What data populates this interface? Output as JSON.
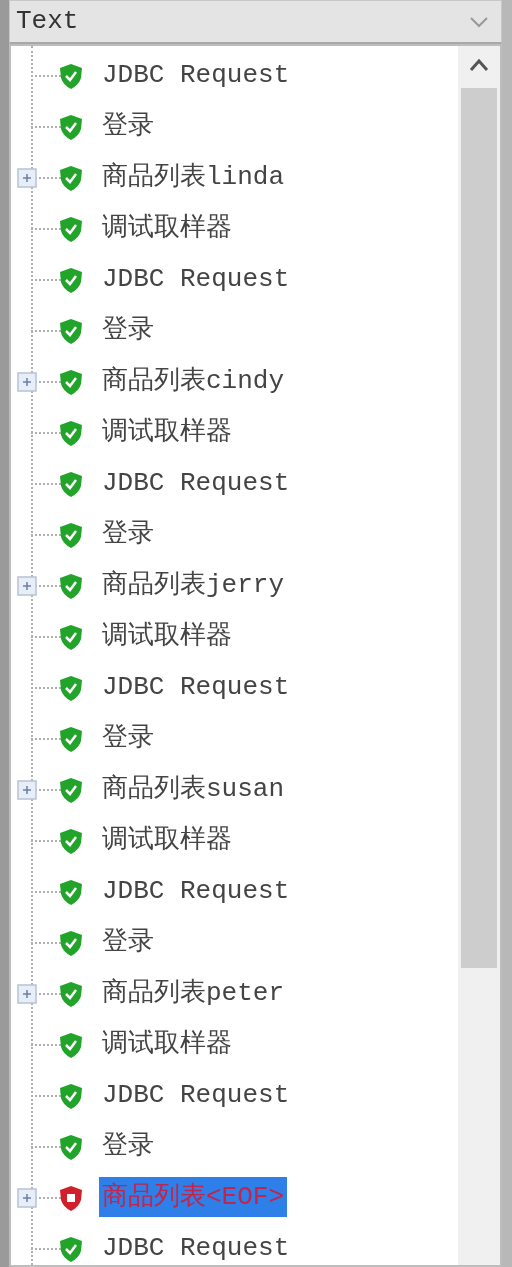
{
  "view_selector": {
    "value": "Text"
  },
  "tree": [
    {
      "label": "JDBC Request",
      "expandable": false,
      "passed": true,
      "selected": false
    },
    {
      "label": "登录",
      "expandable": false,
      "passed": true,
      "selected": false
    },
    {
      "label": "商品列表linda",
      "expandable": true,
      "passed": true,
      "selected": false
    },
    {
      "label": "调试取样器",
      "expandable": false,
      "passed": true,
      "selected": false
    },
    {
      "label": "JDBC Request",
      "expandable": false,
      "passed": true,
      "selected": false
    },
    {
      "label": "登录",
      "expandable": false,
      "passed": true,
      "selected": false
    },
    {
      "label": "商品列表cindy",
      "expandable": true,
      "passed": true,
      "selected": false
    },
    {
      "label": "调试取样器",
      "expandable": false,
      "passed": true,
      "selected": false
    },
    {
      "label": "JDBC Request",
      "expandable": false,
      "passed": true,
      "selected": false
    },
    {
      "label": "登录",
      "expandable": false,
      "passed": true,
      "selected": false
    },
    {
      "label": "商品列表jerry",
      "expandable": true,
      "passed": true,
      "selected": false
    },
    {
      "label": "调试取样器",
      "expandable": false,
      "passed": true,
      "selected": false
    },
    {
      "label": "JDBC Request",
      "expandable": false,
      "passed": true,
      "selected": false
    },
    {
      "label": "登录",
      "expandable": false,
      "passed": true,
      "selected": false
    },
    {
      "label": "商品列表susan",
      "expandable": true,
      "passed": true,
      "selected": false
    },
    {
      "label": "调试取样器",
      "expandable": false,
      "passed": true,
      "selected": false
    },
    {
      "label": "JDBC Request",
      "expandable": false,
      "passed": true,
      "selected": false
    },
    {
      "label": "登录",
      "expandable": false,
      "passed": true,
      "selected": false
    },
    {
      "label": "商品列表peter",
      "expandable": true,
      "passed": true,
      "selected": false
    },
    {
      "label": "调试取样器",
      "expandable": false,
      "passed": true,
      "selected": false
    },
    {
      "label": "JDBC Request",
      "expandable": false,
      "passed": true,
      "selected": false
    },
    {
      "label": "登录",
      "expandable": false,
      "passed": true,
      "selected": false
    },
    {
      "label": "商品列表<EOF>",
      "expandable": true,
      "passed": false,
      "selected": true
    },
    {
      "label": "JDBC Request",
      "expandable": false,
      "passed": true,
      "selected": false
    }
  ]
}
